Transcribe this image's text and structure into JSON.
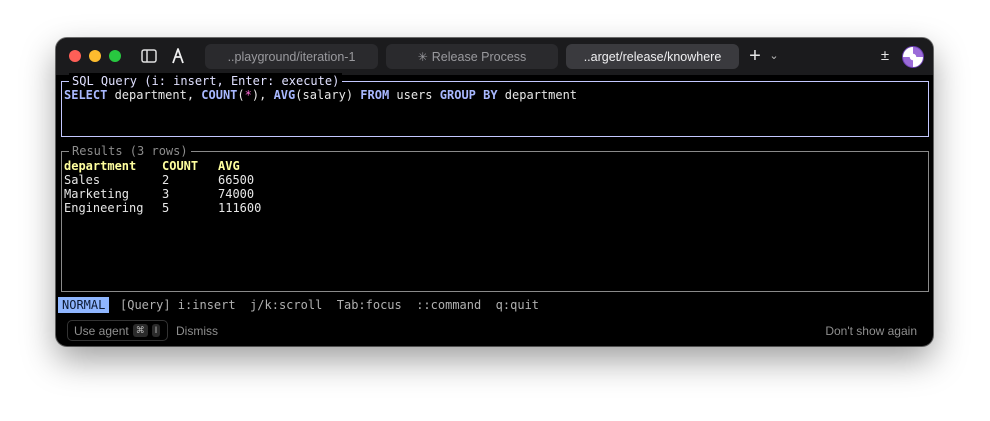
{
  "titlebar": {
    "tabs": [
      {
        "label": "..playground/iteration-1"
      },
      {
        "label": "Release Process",
        "prefix_icon": "asterisk-icon"
      },
      {
        "label": "..arget/release/knowhere"
      }
    ],
    "plus_label": "+",
    "chevron_label": "⌄",
    "plus_minus_label": "±"
  },
  "query_panel": {
    "title": "SQL Query (i: insert, Enter: execute)",
    "tokens": [
      {
        "t": "SELECT",
        "kind": "kw"
      },
      {
        "t": " department, ",
        "kind": "text"
      },
      {
        "t": "COUNT",
        "kind": "kw"
      },
      {
        "t": "(",
        "kind": "text"
      },
      {
        "t": "*",
        "kind": "star"
      },
      {
        "t": "), ",
        "kind": "text"
      },
      {
        "t": "AVG",
        "kind": "kw"
      },
      {
        "t": "(salary) ",
        "kind": "text"
      },
      {
        "t": "FROM",
        "kind": "kw"
      },
      {
        "t": " users ",
        "kind": "text"
      },
      {
        "t": "GROUP BY",
        "kind": "kw"
      },
      {
        "t": " department",
        "kind": "text"
      }
    ]
  },
  "results_panel": {
    "title": "Results (3 rows)",
    "columns": [
      "department",
      "COUNT",
      "AVG"
    ],
    "rows": [
      [
        "Sales",
        "2",
        "66500"
      ],
      [
        "Marketing",
        "3",
        "74000"
      ],
      [
        "Engineering",
        "5",
        "111600"
      ]
    ]
  },
  "status_bar": {
    "mode": "NORMAL",
    "text": "[Query] i:insert  j/k:scroll  Tab:focus  ::command  q:quit"
  },
  "footer": {
    "use_agent_label": "Use agent",
    "shortcut_cmd": "⌘",
    "shortcut_key": "I",
    "dismiss_label": "Dismiss",
    "dont_show_label": "Don't show again"
  },
  "colors": {
    "keyword": "#a8b8ff",
    "star": "#ff6bd6",
    "header": "#ffff9e",
    "mode_bg": "#8fb6ff"
  }
}
